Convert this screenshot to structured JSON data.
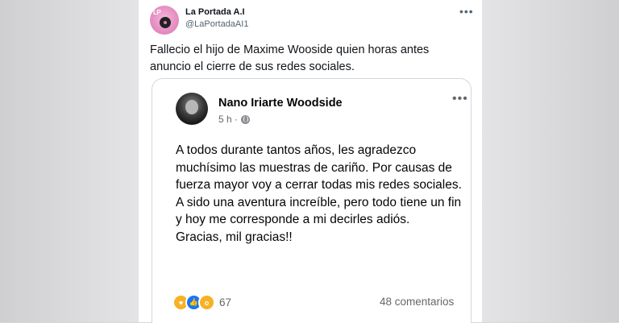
{
  "tweet": {
    "display_name": "La Portada A.I",
    "handle": "@LaPortadaAI1",
    "more_icon": "more-horizontal-icon",
    "text": "Fallecio el hijo de Maxime Wooside quien horas antes anuncio el cierre de sus redes sociales."
  },
  "quoted_post": {
    "author": "Nano Iriarte Woodside",
    "time": "5 h ·",
    "privacy_icon": "globe-icon",
    "paragraphs": [
      "A todos durante tantos años, les agradezco muchísimo las muestras de cariño. Por causas de fuerza mayor voy a cerrar todas mis redes sociales.",
      "A sido una aventura increíble, pero todo tiene un fin y hoy me corresponde a mi decirles adiós.",
      "Gracias, mil gracias!!"
    ],
    "reactions": {
      "icons": [
        "care-reaction-icon",
        "like-reaction-icon",
        "wow-reaction-icon"
      ],
      "count": "67"
    },
    "comments": "48 comentarios"
  },
  "colors": {
    "primary_text": "#0f1419",
    "secondary_text": "#536471",
    "fb_secondary": "#65676b",
    "like_blue": "#1877f2",
    "reaction_yellow": "#f7b125"
  }
}
